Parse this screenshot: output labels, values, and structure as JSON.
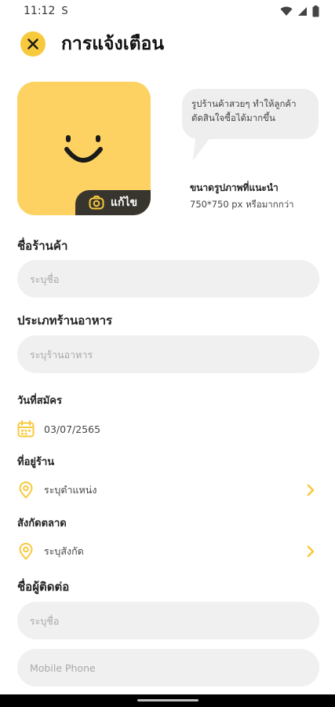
{
  "statusbar": {
    "time": "11:12",
    "sim_glyph": "S"
  },
  "header": {
    "title": "การแจ้งเตือน"
  },
  "photo": {
    "edit_label": "แก้ไข"
  },
  "bubble": {
    "text": "รูปร้านค้าสวยๆ ทำให้ลูกค้าตัดสินใจซื้อได้มากขึ้น"
  },
  "photo_size": {
    "title": "ขนาดรูปภาพที่แนะนำ",
    "value": "750*750 px หรือมากกว่า"
  },
  "store_name": {
    "label": "ชื่อร้านค้า",
    "placeholder": "ระบุชื่อ"
  },
  "store_type": {
    "label": "ประเภทร้านอาหาร",
    "placeholder": "ระบุร้านอาหาร"
  },
  "register_date": {
    "label": "วันที่สมัคร",
    "value": "03/07/2565"
  },
  "address": {
    "label": "ที่อยู่ร้าน",
    "placeholder": "ระบุตำแหน่ง"
  },
  "affiliation": {
    "label": "สังกัดตลาด",
    "placeholder": "ระบุสังกัด"
  },
  "contact": {
    "label": "ชื่อผู้ติดต่อ",
    "name_placeholder": "ระบุชื่อ",
    "phone_placeholder": "Mobile Phone"
  },
  "colors": {
    "accent": "#f8c93c",
    "photo_bg": "#fdd263",
    "pill_bg": "#37352e",
    "field_bg": "#f0f0f0"
  }
}
